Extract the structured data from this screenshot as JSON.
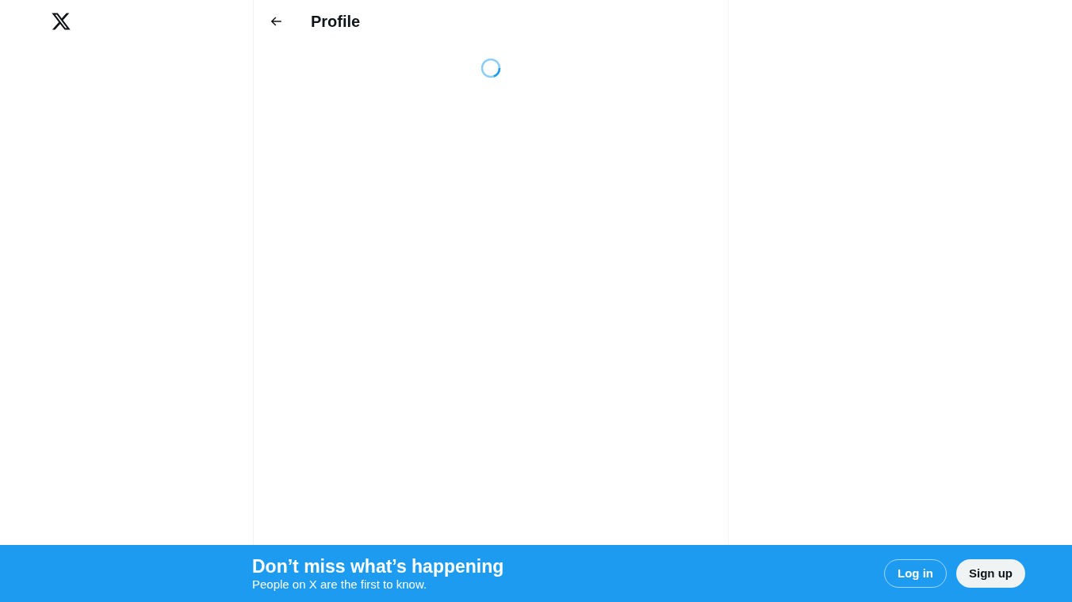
{
  "header": {
    "title": "Profile"
  },
  "banner": {
    "title": "Don’t miss what’s happening",
    "subtitle": "People on X are the first to know.",
    "buttons": [
      {
        "label": "Log in",
        "kind": "outline"
      },
      {
        "label": "Sign up",
        "kind": "filled"
      }
    ]
  }
}
